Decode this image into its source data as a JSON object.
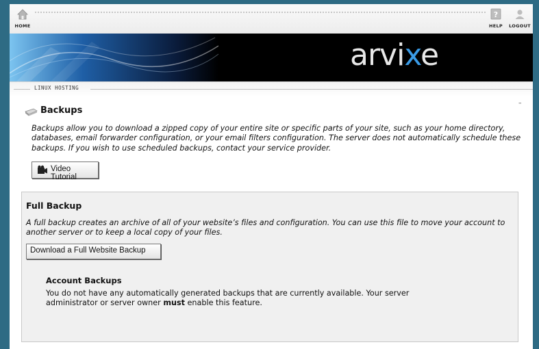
{
  "nav": {
    "home_label": "HOME",
    "help_label": "HELP",
    "logout_label": "LOGOUT"
  },
  "banner": {
    "logo_text_main": "arvi",
    "logo_text_accent": "x",
    "logo_text_end": "e",
    "accent_color": "#3a9be6"
  },
  "section": {
    "tab_label": "LINUX HOSTING",
    "collapse_glyph": "–"
  },
  "page": {
    "title": "Backups",
    "intro": "Backups allow you to download a zipped copy of your entire site or specific parts of your site, such as your home directory, databases, email forwarder configuration, or your email filters configuration. The server does not automatically schedule these backups. If you wish to use scheduled backups, contact your service provider.",
    "video_button_label": "Video Tutorial"
  },
  "full_backup": {
    "title": "Full Backup",
    "description": "A full backup creates an archive of all of your website’s files and configuration. You can use this file to move your account to another server or to keep a local copy of your files.",
    "download_button_label": "Download a Full Website Backup"
  },
  "account_backups": {
    "title": "Account Backups",
    "message_before": "You do not have any automatically generated backups that are currently available. Your server administrator or server owner ",
    "message_bold": "must",
    "message_after": " enable this feature."
  }
}
